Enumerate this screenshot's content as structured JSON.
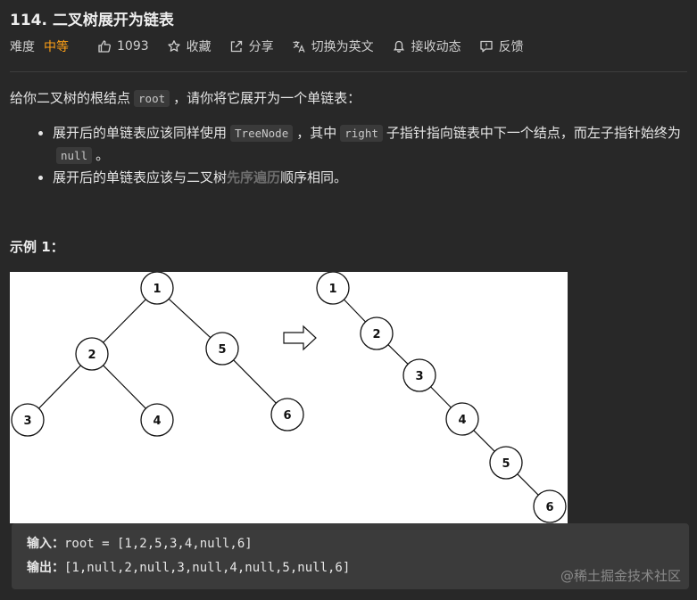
{
  "problem": {
    "title": "114. 二叉树展开为链表",
    "difficulty_label": "难度",
    "difficulty_value": "中等",
    "likes": "1093",
    "favorite": "收藏",
    "share": "分享",
    "switch_language": "切换为英文",
    "notify": "接收动态",
    "feedback": "反馈"
  },
  "description": {
    "intro_1": "给你二叉树的根结点",
    "intro_code": "root",
    "intro_2": "，请你将它展开为一个单链表：",
    "bullet1_a": "展开后的单链表应该同样使用",
    "bullet1_code1": "TreeNode",
    "bullet1_b": "，其中",
    "bullet1_code2": "right",
    "bullet1_c": "子指针指向链表中下一个结点，而左子指针始终为",
    "bullet1_code3": "null",
    "bullet1_d": "。",
    "bullet2_a": "展开后的单链表应该与二叉树",
    "bullet2_link": "先序遍历",
    "bullet2_b": "顺序相同。"
  },
  "example": {
    "title": "示例 1：",
    "input_label": "输入：",
    "input_value": "root = [1,2,5,3,4,null,6]",
    "output_label": "输出：",
    "output_value": "[1,null,2,null,3,null,4,null,5,null,6]"
  },
  "figure": {
    "tree_nodes": [
      "1",
      "2",
      "5",
      "3",
      "4",
      "6"
    ],
    "list_nodes": [
      "1",
      "2",
      "3",
      "4",
      "5",
      "6"
    ]
  },
  "watermark": "@稀土掘金技术社区",
  "colors": {
    "background": "#282828",
    "accent_difficulty": "#ffa116",
    "code_bg": "#3a3a3a",
    "io_bg": "#3b3b3b"
  },
  "icons": [
    "thumbs-up-icon",
    "star-icon",
    "share-icon",
    "translate-icon",
    "bell-icon",
    "feedback-icon"
  ]
}
